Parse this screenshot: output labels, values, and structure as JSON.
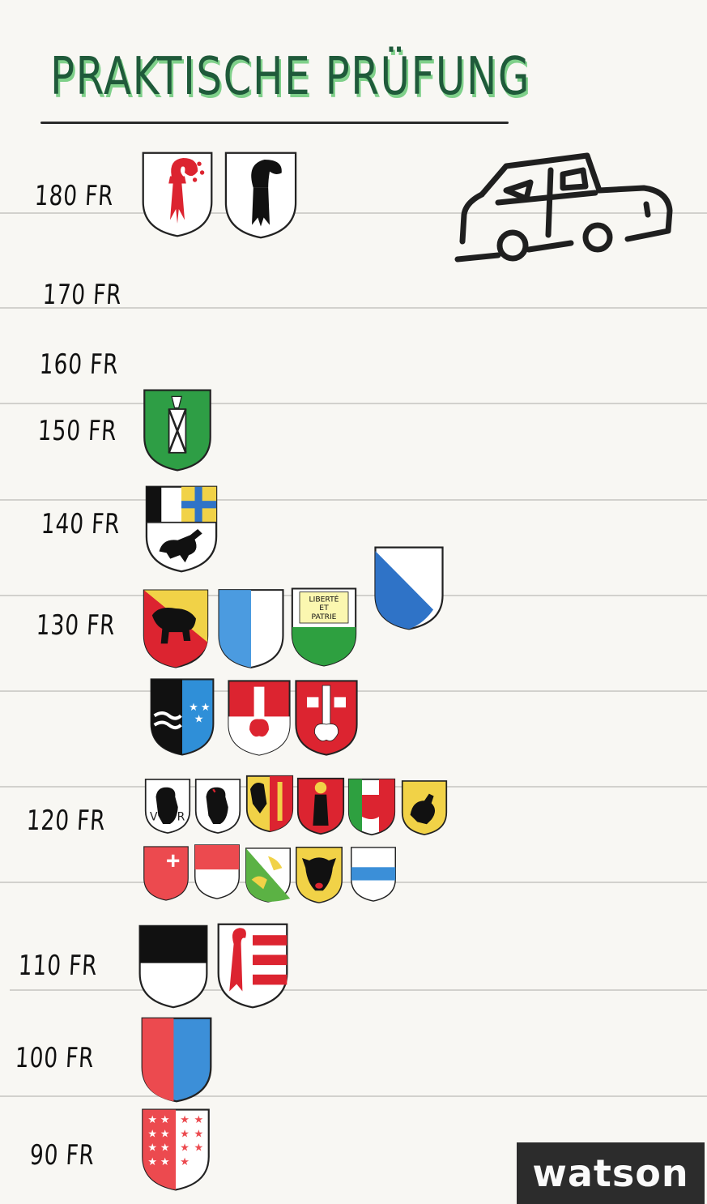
{
  "title": "PRAKTISCHE PRÜFUNG",
  "logo": "watson",
  "prices": [
    "180 FR",
    "170 FR",
    "160 FR",
    "150 FR",
    "140 FR",
    "130 FR",
    "120 FR",
    "110 FR",
    "100 FR",
    "90 FR"
  ],
  "colors": {
    "paper": "#f8f7f3",
    "rule": "#d2d1cd",
    "title": "#1f5a3a",
    "title_shadow": "#7fd08a",
    "red": "#dc2430",
    "green": "#2e9e45",
    "blue": "#2f73c7",
    "yellow": "#f1d247"
  },
  "icons": [
    "basel-landschaft-crest",
    "basel-stadt-crest",
    "st-gallen-crest",
    "graubuenden-crest",
    "zurich-crest",
    "bern-crest",
    "lucerne-crest",
    "vaud-crest",
    "aargau-crest",
    "obwalden-crest",
    "nidwalden-crest",
    "appenzell-ausserrhoden-crest",
    "appenzell-innerrhoden-crest",
    "geneva-crest",
    "glarus-crest",
    "ticino-crest",
    "schaffhausen-crest",
    "schwyz-crest",
    "solothurn-crest",
    "thurgau-crest",
    "uri-crest",
    "zug-crest",
    "fribourg-crest",
    "jura-crest",
    "neuchatel-crest",
    "valais-crest",
    "car-drawing",
    "watson-logo"
  ]
}
